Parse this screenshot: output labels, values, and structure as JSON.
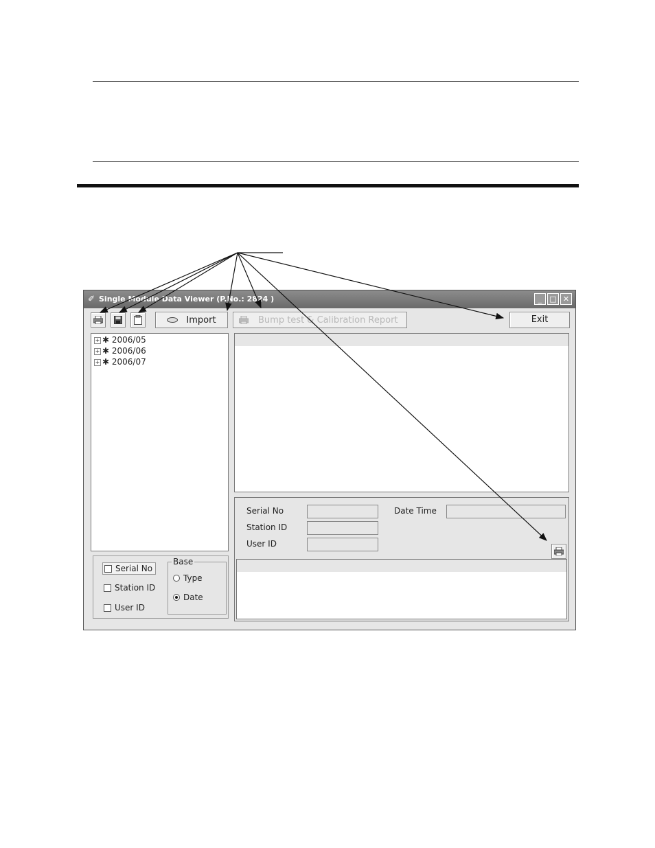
{
  "window": {
    "title": "Single Module Data Viewer (P.No.: 2824 )",
    "controls": [
      "_",
      "□",
      "✕"
    ]
  },
  "toolbar": {
    "import_label": "Import",
    "report_label": "Bump test & Calibration Report",
    "exit_label": "Exit",
    "icons": [
      "printer-icon",
      "save-icon",
      "clipboard-icon",
      "drive-icon",
      "printer-icon"
    ]
  },
  "tree": {
    "items": [
      {
        "label": "2006/05"
      },
      {
        "label": "2006/06"
      },
      {
        "label": "2006/07"
      }
    ]
  },
  "details": {
    "serial_label": "Serial No",
    "station_label": "Station ID",
    "user_label": "User ID",
    "datetime_label": "Date Time",
    "serial_value": "",
    "station_value": "",
    "user_value": "",
    "datetime_value": ""
  },
  "filters": {
    "serial": {
      "label": "Serial No",
      "checked": false
    },
    "station": {
      "label": "Station ID",
      "checked": false
    },
    "user": {
      "label": "User ID",
      "checked": false
    }
  },
  "base": {
    "title": "Base",
    "type": {
      "label": "Type",
      "selected": false
    },
    "date": {
      "label": "Date",
      "selected": true
    }
  },
  "colors": {
    "window_bg": "#e6e6e6",
    "titlebar": "#7a7a7a",
    "rule": "#111111"
  }
}
